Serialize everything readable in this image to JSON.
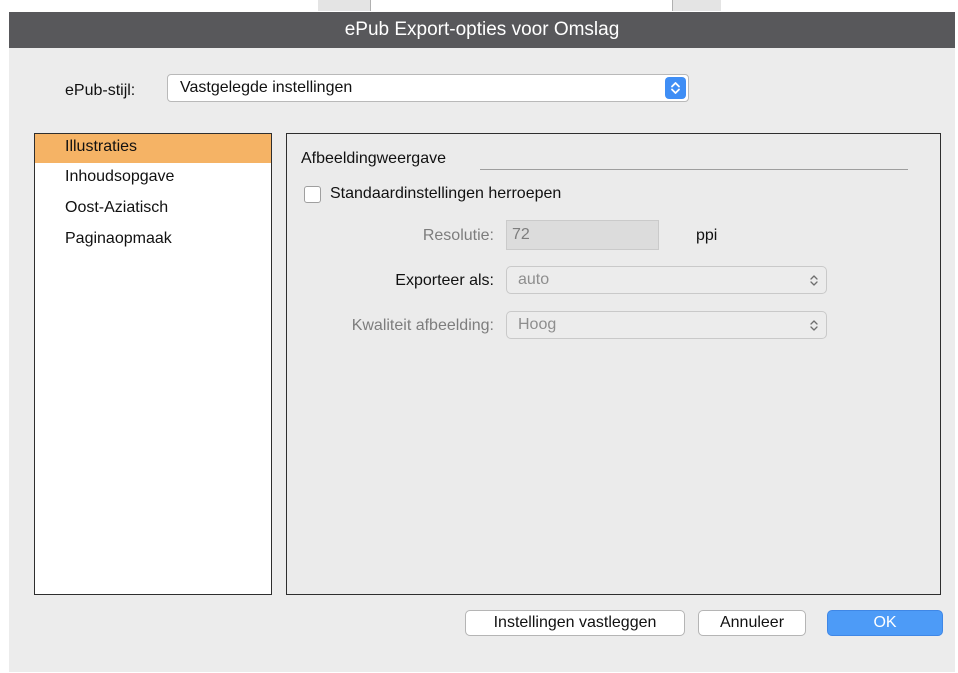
{
  "window": {
    "title": "ePub Export-opties voor Omslag"
  },
  "epub_style": {
    "label": "ePub-stijl:",
    "value": "Vastgelegde instellingen"
  },
  "sidebar": {
    "items": [
      {
        "label": "Illustraties",
        "selected": true
      },
      {
        "label": "Inhoudsopgave",
        "selected": false
      },
      {
        "label": "Oost-Aziatisch",
        "selected": false
      },
      {
        "label": "Paginaopmaak",
        "selected": false
      }
    ]
  },
  "panel": {
    "group_title": "Afbeeldingweergave",
    "reset_checkbox": {
      "label": "Standaardinstellingen herroepen",
      "checked": false
    },
    "resolution": {
      "label": "Resolutie:",
      "value": "72",
      "unit": "ppi"
    },
    "export_as": {
      "label": "Exporteer als:",
      "value": "auto"
    },
    "quality": {
      "label": "Kwaliteit afbeelding:",
      "value": "Hoog"
    }
  },
  "buttons": {
    "save_settings": "Instellingen vastleggen",
    "cancel": "Annuleer",
    "ok": "OK"
  },
  "colors": {
    "titlebar": "#58585b",
    "selection": "#f5b365",
    "accent": "#4d9bf7"
  }
}
